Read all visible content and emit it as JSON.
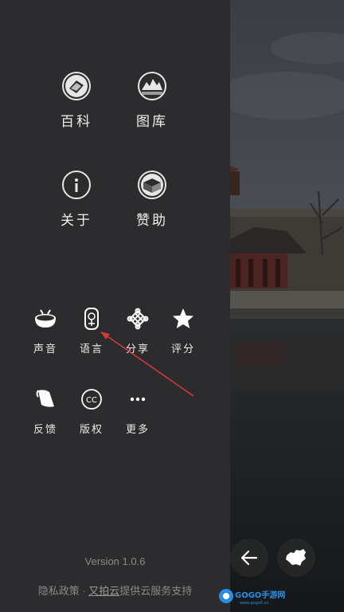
{
  "menu": {
    "encyclopedia": "百科",
    "gallery": "图库",
    "about": "关于",
    "sponsor": "赞助",
    "sound": "声音",
    "language": "语言",
    "share": "分享",
    "rate": "评分",
    "feedback": "反馈",
    "copyright": "版权",
    "more": "更多"
  },
  "version": "Version 1.0.6",
  "footer": {
    "privacy": "隐私政策",
    "separator": " · ",
    "provider_link": "又拍云",
    "provider_text": "提供云服务支持"
  },
  "watermark": {
    "text": "GOGO手游网",
    "sub": "www.gogo6.cn"
  },
  "icons": {
    "encyclopedia": "encyclopedia-icon",
    "gallery": "gallery-mountain-icon",
    "about": "info-icon",
    "sponsor": "sponsor-box-icon",
    "sound": "drum-icon",
    "language": "language-seal-icon",
    "share": "chinese-knot-icon",
    "rate": "star-icon",
    "feedback": "feedback-scroll-icon",
    "copyright": "cc-icon",
    "more": "more-dots-icon",
    "back": "arrow-left-icon",
    "map": "china-map-icon"
  },
  "colors": {
    "drawer_bg": "#2c2c2e",
    "text": "#f0f0f0",
    "muted": "#8a8a8a",
    "arrow_annotation": "#d33b3b"
  }
}
